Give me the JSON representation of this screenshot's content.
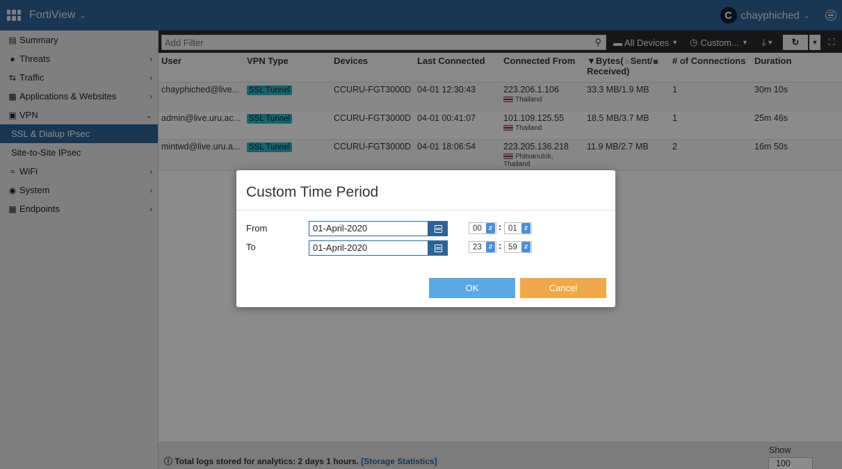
{
  "topbar": {
    "app_title": "FortiView",
    "user_initial": "C",
    "user_name": "chayphiched"
  },
  "sidebar": {
    "items": [
      {
        "label": "Summary",
        "icon": "summary-icon"
      },
      {
        "label": "Threats",
        "icon": "threats-icon"
      },
      {
        "label": "Traffic",
        "icon": "traffic-icon"
      },
      {
        "label": "Applications & Websites",
        "icon": "grid-icon"
      },
      {
        "label": "VPN",
        "icon": "lock-icon"
      },
      {
        "label": "WiFi",
        "icon": "wifi-icon"
      },
      {
        "label": "System",
        "icon": "system-icon"
      },
      {
        "label": "Endpoints",
        "icon": "endpoints-icon"
      }
    ],
    "vpn_sub": [
      "SSL & Dialup IPsec",
      "Site-to-Site IPsec"
    ]
  },
  "toolbar": {
    "filter_placeholder": "Add Filter",
    "devices_label": "All Devices",
    "time_label": "Custom..."
  },
  "table": {
    "columns": [
      "User",
      "VPN Type",
      "Devices",
      "Last Connected",
      "Connected From",
      "Bytes(",
      "Sent/",
      "Received)",
      "# of Connections",
      "Duration"
    ],
    "rows": [
      {
        "user": "chayphiched@live...",
        "vpn_type": "SSL Tunnel",
        "device": "CCURU-FGT3000D",
        "last_connected": "04-01 12:30:43",
        "ip": "223.206.1.106",
        "location": "Thailand",
        "bytes": "33.3 MB/1.9 MB",
        "connections": "1",
        "duration": "30m 10s"
      },
      {
        "user": "admin@live.uru.ac...",
        "vpn_type": "SSL Tunnel",
        "device": "CCURU-FGT3000D",
        "last_connected": "04-01 00:41:07",
        "ip": "101.109.125.55",
        "location": "Thailand",
        "bytes": "18.5 MB/3.7 MB",
        "connections": "1",
        "duration": "25m 46s"
      },
      {
        "user": "mintwd@live.uru.a...",
        "vpn_type": "SSL Tunnel",
        "device": "CCURU-FGT3000D",
        "last_connected": "04-01 18:06:54",
        "ip": "223.205.136.218",
        "location": "Phitsanulok, Thailand",
        "bytes": "11.9 MB/2.7 MB",
        "connections": "2",
        "duration": "16m 50s"
      }
    ]
  },
  "footer": {
    "info_text": "Total logs stored for analytics: 2 days 1 hours.",
    "link_text": "[Storage Statistics]",
    "show_label": "Show",
    "show_value": "100"
  },
  "modal": {
    "title": "Custom Time Period",
    "from_label": "From",
    "to_label": "To",
    "from_date": "01-April-2020",
    "to_date": "01-April-2020",
    "from_hour": "00",
    "from_minute": "01",
    "to_hour": "23",
    "to_minute": "59",
    "ok_label": "OK",
    "cancel_label": "Cancel"
  }
}
